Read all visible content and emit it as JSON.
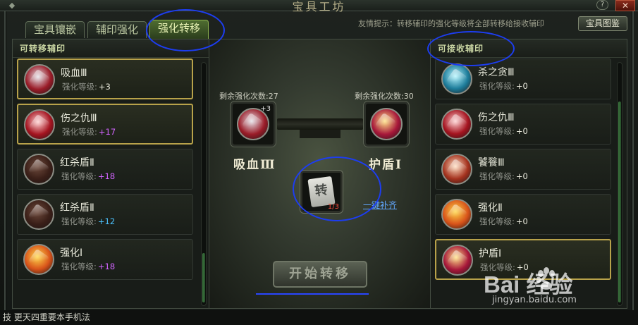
{
  "window": {
    "title": "宝具工坊",
    "help_label": "?",
    "close_label": "✕"
  },
  "tabs": [
    {
      "label": "宝具镶嵌",
      "active": false
    },
    {
      "label": "辅印强化",
      "active": false
    },
    {
      "label": "强化转移",
      "active": true
    }
  ],
  "hint": "友情提示：转移辅印的强化等级将全部转移给接收辅印",
  "album_button": "宝具图鉴",
  "left_panel": {
    "title": "可转移辅印",
    "items": [
      {
        "name": "吸血Ⅲ",
        "level_label": "强化等级:",
        "level": "+3",
        "level_color": "#e9e9dc",
        "selected": true,
        "icon": "vampire-gem-icon",
        "c1": "#e6e4ea",
        "c2": "#9a1c28"
      },
      {
        "name": "伤之仇Ⅲ",
        "level_label": "强化等级:",
        "level": "+17",
        "level_color": "#d264ff",
        "selected": true,
        "icon": "claw-gem-icon",
        "c1": "#ffd1d1",
        "c2": "#a51420"
      },
      {
        "name": "红杀盾Ⅱ",
        "level_label": "强化等级:",
        "level": "+18",
        "level_color": "#d264ff",
        "selected": false,
        "icon": "red-shield-icon",
        "c1": "#6e4a3c",
        "c2": "#3a1f18"
      },
      {
        "name": "红杀盾Ⅱ",
        "level_label": "强化等级:",
        "level": "+12",
        "level_color": "#4cc3ff",
        "selected": false,
        "icon": "red-shield-icon",
        "c1": "#6e4a3c",
        "c2": "#3a1f18"
      },
      {
        "name": "强化Ⅰ",
        "level_label": "强化等级:",
        "level": "+18",
        "level_color": "#d264ff",
        "selected": false,
        "icon": "fire-sword-icon",
        "c1": "#ffd84a",
        "c2": "#d8531a"
      }
    ]
  },
  "right_panel": {
    "title": "可接收辅印",
    "items": [
      {
        "name": "杀之贪Ⅲ",
        "level_label": "强化等级:",
        "level": "+0",
        "level_color": "#e9e9dc",
        "selected": false,
        "icon": "blue-beast-icon",
        "c1": "#b6f6ff",
        "c2": "#1d7c9a"
      },
      {
        "name": "伤之仇Ⅲ",
        "level_label": "强化等级:",
        "level": "+0",
        "level_color": "#e9e9dc",
        "selected": false,
        "icon": "claw-gem-icon",
        "c1": "#ffd1d1",
        "c2": "#a51420"
      },
      {
        "name": "饕餮Ⅲ",
        "level_label": "强化等级:",
        "level": "+0",
        "level_color": "#e9e9dc",
        "selected": false,
        "icon": "dragon-icon",
        "c1": "#ffe0c4",
        "c2": "#a4321e"
      },
      {
        "name": "强化Ⅱ",
        "level_label": "强化等级:",
        "level": "+0",
        "level_color": "#e9e9dc",
        "selected": false,
        "icon": "fire-sword-icon",
        "c1": "#ffd84a",
        "c2": "#d8531a"
      },
      {
        "name": "护盾Ⅰ",
        "level_label": "强化等级:",
        "level": "+0",
        "level_color": "#e9e9dc",
        "selected": true,
        "icon": "gold-shield-icon",
        "c1": "#ffe488",
        "c2": "#a7173a"
      }
    ]
  },
  "transfer": {
    "source": {
      "remaining_label": "剩余强化次数:",
      "remaining": "27",
      "name": "吸血Ⅲ",
      "plus": "+3",
      "icon": "vampire-gem-icon",
      "c1": "#e6e4ea",
      "c2": "#9a1c28"
    },
    "target": {
      "remaining_label": "剩余强化次数:",
      "remaining": "30",
      "name": "护盾Ⅰ",
      "icon": "gold-shield-icon",
      "c1": "#ffe488",
      "c2": "#a7173a"
    },
    "scroll_char": "转",
    "scroll_qty": "1/3",
    "one_click_label": "一键补齐",
    "start_label": "开始转移"
  },
  "background": {
    "bottom_text": "技  更天四重要本手机法"
  },
  "watermark": {
    "brand": "Bai  经验",
    "url": "jingyan.baidu.com"
  }
}
